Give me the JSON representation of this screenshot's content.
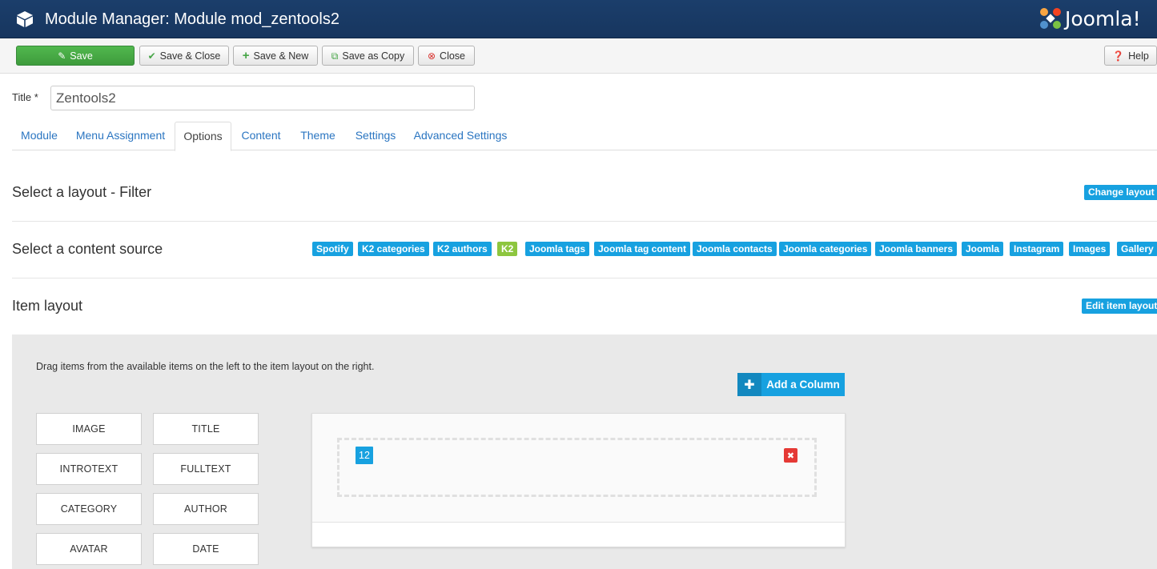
{
  "header": {
    "title": "Module Manager: Module mod_zentools2",
    "logo_text": "Joomla!",
    "icons": {
      "module": "cube-icon",
      "logo": "joomla-logo-icon"
    }
  },
  "toolbar": {
    "save": "Save",
    "save_close": "Save & Close",
    "save_new": "Save & New",
    "save_copy": "Save as Copy",
    "close": "Close",
    "help": "Help"
  },
  "form": {
    "title_label": "Title *",
    "title_value": "Zentools2"
  },
  "tabs": [
    "Module",
    "Menu Assignment",
    "Options",
    "Content",
    "Theme",
    "Settings",
    "Advanced Settings"
  ],
  "active_tab": "Options",
  "layout_section": {
    "title": "Select a layout - Filter",
    "action": "Change layout"
  },
  "source_section": {
    "title": "Select a content source",
    "sources": [
      "Spotify",
      "K2 categories",
      "K2 authors",
      "K2",
      "Joomla tags",
      "Joomla tag content",
      "Joomla contacts",
      "Joomla categories",
      "Joomla banners",
      "Joomla",
      "Instagram",
      "Images",
      "Gallery"
    ],
    "selected": "K2"
  },
  "item_section": {
    "title": "Item layout",
    "action": "Edit item layout",
    "hint": "Drag items from the available items on the left to the item layout on the right.",
    "add_column": "Add a Column",
    "available_items": [
      "IMAGE",
      "TITLE",
      "INTROTEXT",
      "FULLTEXT",
      "CATEGORY",
      "AUTHOR",
      "AVATAR",
      "DATE"
    ],
    "column_width": "12"
  },
  "colors": {
    "header_bg": "#1b3e6b",
    "save_green": "#46a546",
    "chip_blue": "#17a1e0",
    "chip_green": "#8dc63f",
    "tab_link": "#2a75c1",
    "remove_red": "#e53935"
  }
}
